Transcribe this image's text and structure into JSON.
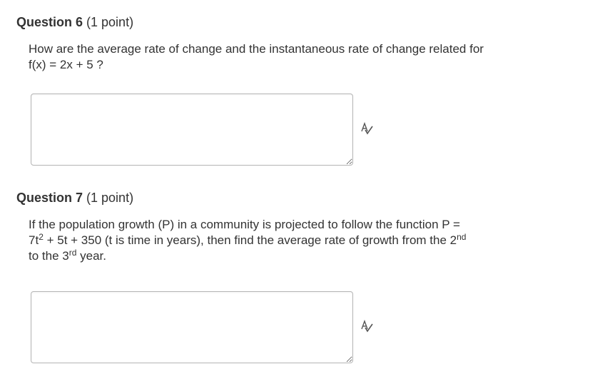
{
  "questions": [
    {
      "title": "Question 6",
      "points": "(1 point)",
      "text_line1": "How are the average rate of change and the instantaneous rate of change related for",
      "text_line2": "f(x) = 2x + 5 ?",
      "answer_value": "",
      "spellcheck_icon": "spellcheck-icon"
    },
    {
      "title": "Question 7",
      "points": "(1 point)",
      "text_part1": "If the population growth (P) in a community is projected to follow the function P =",
      "text_part2": "7t",
      "text_sup1": "2",
      "text_part3": " + 5t + 350 (t is time in years), then find the average rate of growth from the 2",
      "text_sup2": "nd",
      "text_part4": "to the 3",
      "text_sup3": "rd",
      "text_part5": " year.",
      "answer_value": "",
      "spellcheck_icon": "spellcheck-icon"
    }
  ]
}
